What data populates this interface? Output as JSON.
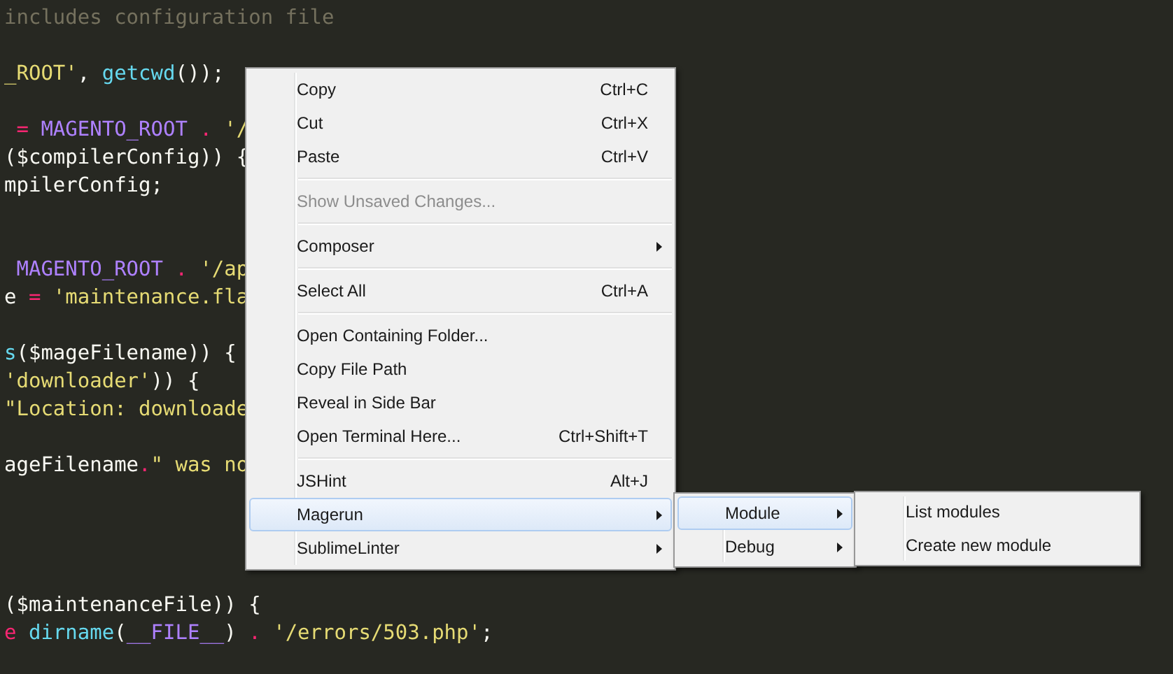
{
  "editor": {
    "code_lines": [
      {
        "kind": "code",
        "tokens": [
          {
            "color": "#75715e",
            "text": "includes configuration file"
          }
        ]
      },
      {
        "kind": "blank"
      },
      {
        "kind": "code",
        "tokens": [
          {
            "color": "#e6db74",
            "text": "_ROOT'"
          },
          {
            "color": "#f8f8f2",
            "text": ", "
          },
          {
            "color": "#66d9ef",
            "text": "getcwd"
          },
          {
            "color": "#f8f8f2",
            "text": "());"
          }
        ]
      },
      {
        "kind": "blank"
      },
      {
        "kind": "code",
        "tokens": [
          {
            "color": "#f92672",
            "text": " ="
          },
          {
            "color": "#ae81ff",
            "text": " MAGENTO_ROOT"
          },
          {
            "color": "#f92672",
            "text": " ."
          },
          {
            "color": "#e6db74",
            "text": " '/"
          }
        ]
      },
      {
        "kind": "code",
        "tokens": [
          {
            "color": "#f8f8f2",
            "text": "($compilerConfig)) {"
          }
        ]
      },
      {
        "kind": "code",
        "tokens": [
          {
            "color": "#f8f8f2",
            "text": "mpilerConfig;"
          }
        ]
      },
      {
        "kind": "blank"
      },
      {
        "kind": "blank"
      },
      {
        "kind": "code",
        "tokens": [
          {
            "color": "#ae81ff",
            "text": " MAGENTO_ROOT"
          },
          {
            "color": "#f92672",
            "text": " ."
          },
          {
            "color": "#e6db74",
            "text": " '/ap"
          }
        ]
      },
      {
        "kind": "code",
        "tokens": [
          {
            "color": "#f8f8f2",
            "text": "e "
          },
          {
            "color": "#f92672",
            "text": "="
          },
          {
            "color": "#e6db74",
            "text": " 'maintenance.fla"
          }
        ]
      },
      {
        "kind": "blank"
      },
      {
        "kind": "code",
        "tokens": [
          {
            "color": "#66d9ef",
            "text": "s"
          },
          {
            "color": "#f8f8f2",
            "text": "($mageFilename)) {"
          }
        ]
      },
      {
        "kind": "code",
        "tokens": [
          {
            "color": "#e6db74",
            "text": "'downloader'"
          },
          {
            "color": "#f8f8f2",
            "text": ")) {"
          }
        ]
      },
      {
        "kind": "code",
        "tokens": [
          {
            "color": "#e6db74",
            "text": "\"Location: downloade"
          }
        ]
      },
      {
        "kind": "blank"
      },
      {
        "kind": "code",
        "tokens": [
          {
            "color": "#f8f8f2",
            "text": "ageFilename"
          },
          {
            "color": "#f92672",
            "text": "."
          },
          {
            "color": "#e6db74",
            "text": "\" was no"
          }
        ]
      },
      {
        "kind": "blank"
      },
      {
        "kind": "blank"
      },
      {
        "kind": "blank"
      },
      {
        "kind": "blank"
      },
      {
        "kind": "code",
        "tokens": [
          {
            "color": "#f8f8f2",
            "text": "($maintenanceFile)) {"
          }
        ]
      },
      {
        "kind": "code",
        "tokens": [
          {
            "color": "#f92672",
            "text": "e"
          },
          {
            "color": "#66d9ef",
            "text": " dirname"
          },
          {
            "color": "#f8f8f2",
            "text": "("
          },
          {
            "color": "#ae81ff",
            "text": "__FILE__"
          },
          {
            "color": "#f8f8f2",
            "text": ")"
          },
          {
            "color": "#f92672",
            "text": " ."
          },
          {
            "color": "#e6db74",
            "text": " '/errors/503.php'"
          },
          {
            "color": "#f8f8f2",
            "text": ";"
          }
        ]
      }
    ]
  },
  "context_menu": {
    "items": [
      {
        "kind": "item",
        "label": "Copy",
        "shortcut": "Ctrl+C",
        "disabled": false,
        "selected": false,
        "has_submenu": false
      },
      {
        "kind": "item",
        "label": "Cut",
        "shortcut": "Ctrl+X",
        "disabled": false,
        "selected": false,
        "has_submenu": false
      },
      {
        "kind": "item",
        "label": "Paste",
        "shortcut": "Ctrl+V",
        "disabled": false,
        "selected": false,
        "has_submenu": false
      },
      {
        "kind": "separator"
      },
      {
        "kind": "item",
        "label": "Show Unsaved Changes...",
        "disabled": true,
        "selected": false,
        "has_submenu": false
      },
      {
        "kind": "separator"
      },
      {
        "kind": "item",
        "label": "Composer",
        "disabled": false,
        "selected": false,
        "has_submenu": true
      },
      {
        "kind": "separator"
      },
      {
        "kind": "item",
        "label": "Select All",
        "shortcut": "Ctrl+A",
        "disabled": false,
        "selected": false,
        "has_submenu": false
      },
      {
        "kind": "separator"
      },
      {
        "kind": "item",
        "label": "Open Containing Folder...",
        "disabled": false,
        "selected": false,
        "has_submenu": false
      },
      {
        "kind": "item",
        "label": "Copy File Path",
        "disabled": false,
        "selected": false,
        "has_submenu": false
      },
      {
        "kind": "item",
        "label": "Reveal in Side Bar",
        "disabled": false,
        "selected": false,
        "has_submenu": false
      },
      {
        "kind": "item",
        "label": "Open Terminal Here...",
        "shortcut": "Ctrl+Shift+T",
        "disabled": false,
        "selected": false,
        "has_submenu": false
      },
      {
        "kind": "separator"
      },
      {
        "kind": "item",
        "label": "JSHint",
        "shortcut": "Alt+J",
        "disabled": false,
        "selected": false,
        "has_submenu": false
      },
      {
        "kind": "item",
        "label": "Magerun",
        "disabled": false,
        "selected": true,
        "has_submenu": true,
        "submenu": {
          "items": [
            {
              "kind": "item",
              "label": "Module",
              "disabled": false,
              "selected": true,
              "has_submenu": true,
              "submenu": {
                "items": [
                  {
                    "kind": "item",
                    "label": "List modules",
                    "disabled": false,
                    "selected": false,
                    "has_submenu": false
                  },
                  {
                    "kind": "item",
                    "label": "Create new module",
                    "disabled": false,
                    "selected": false,
                    "has_submenu": false
                  }
                ]
              }
            },
            {
              "kind": "item",
              "label": "Debug",
              "disabled": false,
              "selected": false,
              "has_submenu": true
            }
          ]
        }
      },
      {
        "kind": "item",
        "label": "SublimeLinter",
        "disabled": false,
        "selected": false,
        "has_submenu": true
      }
    ]
  }
}
